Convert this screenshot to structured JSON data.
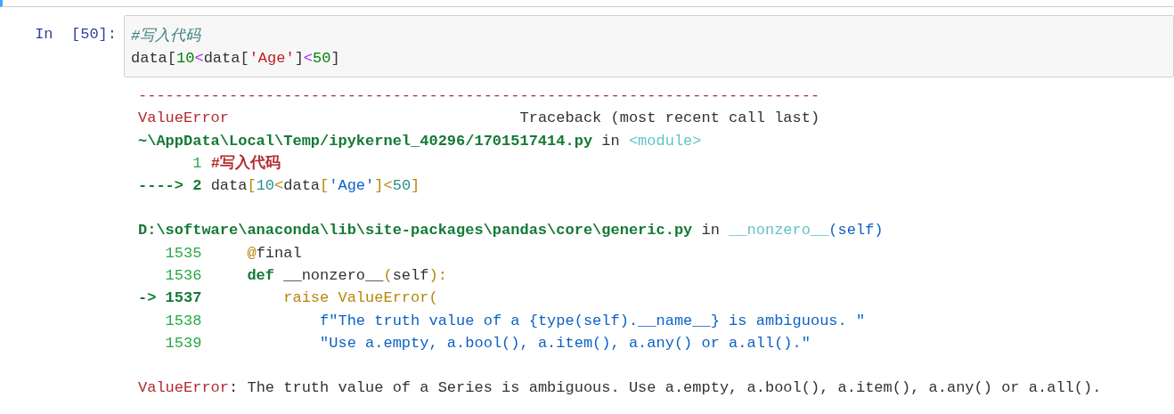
{
  "cell": {
    "prompt": "In  [50]:",
    "input_lines": [
      [
        {
          "text": "#写入代码",
          "kind": "comment"
        }
      ],
      [
        {
          "text": "data",
          "kind": "plain"
        },
        {
          "text": "[",
          "kind": "plain"
        },
        {
          "text": "10",
          "kind": "number"
        },
        {
          "text": "<",
          "kind": "operator"
        },
        {
          "text": "data",
          "kind": "plain"
        },
        {
          "text": "[",
          "kind": "plain"
        },
        {
          "text": "'Age'",
          "kind": "string"
        },
        {
          "text": "]",
          "kind": "plain"
        },
        {
          "text": "<",
          "kind": "operator"
        },
        {
          "text": "50",
          "kind": "number"
        },
        {
          "text": "]",
          "kind": "plain"
        }
      ]
    ]
  },
  "output": {
    "blocks": [
      [
        [
          {
            "text": "---------------------------------------------------------------------------",
            "kind": "error"
          }
        ],
        [
          {
            "text": "ValueError",
            "kind": "error"
          },
          {
            "text": "                                Traceback (most recent call last)",
            "kind": "plain"
          }
        ],
        [
          {
            "text": "~\\AppData\\Local\\Temp/ipykernel_40296/1701517414.py",
            "kind": "path"
          },
          {
            "text": " in ",
            "kind": "plain"
          },
          {
            "text": "<module>",
            "kind": "func"
          }
        ],
        [
          {
            "text": "      1 ",
            "kind": "lineno"
          },
          {
            "text": "#写入代码",
            "kind": "tbcomment"
          }
        ],
        [
          {
            "text": "----> 2 ",
            "kind": "current"
          },
          {
            "text": "data",
            "kind": "plain"
          },
          {
            "text": "[",
            "kind": "bracket"
          },
          {
            "text": "10",
            "kind": "tbnumber"
          },
          {
            "text": "<",
            "kind": "bracket"
          },
          {
            "text": "data",
            "kind": "plain"
          },
          {
            "text": "[",
            "kind": "bracket"
          },
          {
            "text": "'Age'",
            "kind": "tbstring"
          },
          {
            "text": "]",
            "kind": "bracket"
          },
          {
            "text": "<",
            "kind": "bracket"
          },
          {
            "text": "50",
            "kind": "tbnumber"
          },
          {
            "text": "]",
            "kind": "bracket"
          }
        ]
      ],
      [
        [
          {
            "text": "D:\\software\\anaconda\\lib\\site-packages\\pandas\\core\\generic.py",
            "kind": "path"
          },
          {
            "text": " in ",
            "kind": "plain"
          },
          {
            "text": "__nonzero__",
            "kind": "func"
          },
          {
            "text": "(self)",
            "kind": "tbstring"
          }
        ],
        [
          {
            "text": "   1535     ",
            "kind": "lineno"
          },
          {
            "text": "@",
            "kind": "bracket"
          },
          {
            "text": "final",
            "kind": "plain"
          }
        ],
        [
          {
            "text": "   1536     ",
            "kind": "lineno"
          },
          {
            "text": "def",
            "kind": "keyword"
          },
          {
            "text": " __nonzero__",
            "kind": "plain"
          },
          {
            "text": "(",
            "kind": "bracket"
          },
          {
            "text": "self",
            "kind": "plain"
          },
          {
            "text": "):",
            "kind": "bracket"
          }
        ],
        [
          {
            "text": "-> 1537         ",
            "kind": "current"
          },
          {
            "text": "raise ValueError(",
            "kind": "bracket"
          }
        ],
        [
          {
            "text": "   1538             ",
            "kind": "lineno"
          },
          {
            "text": "f\"The truth value of a {type(self).__name__} is ambiguous. \"",
            "kind": "tbstring"
          }
        ],
        [
          {
            "text": "   1539             ",
            "kind": "lineno"
          },
          {
            "text": "\"Use a.empty, a.bool(), a.item(), a.any() or a.all().\"",
            "kind": "tbstring"
          }
        ]
      ],
      [
        [
          {
            "text": "ValueError",
            "kind": "error"
          },
          {
            "text": ": The truth value of a Series is ambiguous. Use a.empty, a.bool(), a.item(), a.any() or a.all().",
            "kind": "plain"
          }
        ]
      ]
    ]
  }
}
